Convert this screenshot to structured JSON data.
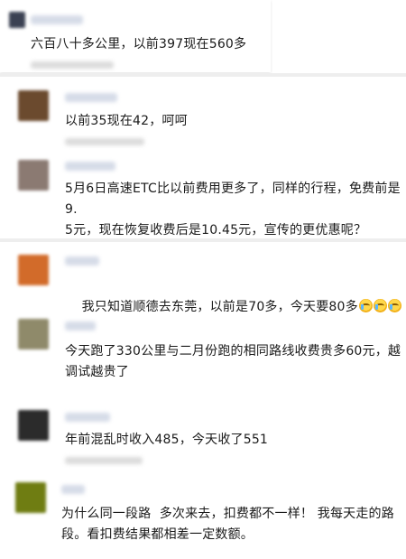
{
  "comments": [
    {
      "id": "c0",
      "text": "六百八十多公里，以前397现在560多",
      "avatar_color": "#3b4152"
    },
    {
      "id": "c1",
      "text": "以前35现在42，呵呵",
      "avatar_color": "#6b4a2e"
    },
    {
      "id": "c2",
      "text": "5月6日高速ETC比以前费用更多了，同样的行程，免费前是9.\n5元，现在恢复收费后是10.45元，宣传的更优惠呢？",
      "avatar_color": "#8b7a72"
    },
    {
      "id": "c3",
      "text": "我只知道顺德去东莞，以前是70多，今天要80多",
      "emoji": "crying-face-icon",
      "emoji_count": 3,
      "avatar_color": "#d26b2a"
    },
    {
      "id": "c4",
      "text": "今天跑了330公里与二月份跑的相同路线收费贵多60元，越\n调试越贵了",
      "avatar_color": "#8f8a6a"
    },
    {
      "id": "c5",
      "text": "年前混乱时收入485，今天收了551",
      "avatar_color": "#2b2b2b"
    },
    {
      "id": "c6",
      "text": "为什么同一段路  多次来去，扣费都不一样！ 我每天走的路\n段。看扣费结果都相差一定数额。",
      "avatar_color": "#6f7d12"
    }
  ]
}
